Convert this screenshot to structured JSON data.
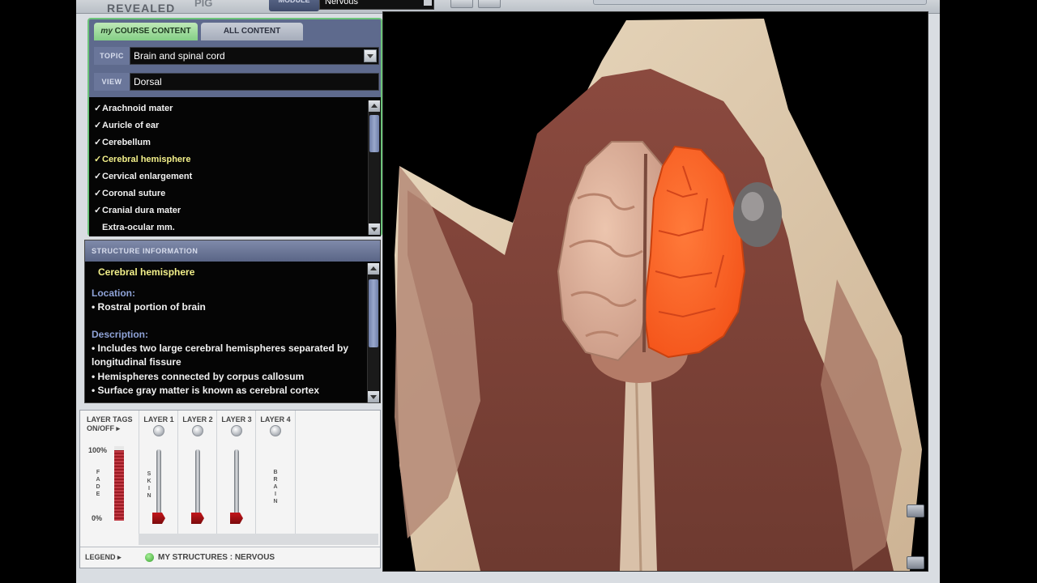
{
  "header": {
    "brand_line": "REVEALED",
    "brand_sub": "PIG",
    "module_label": "MODULE",
    "module_value": "Nervous"
  },
  "course_panel": {
    "tabs": [
      {
        "prefix": "my",
        "label": "COURSE CONTENT",
        "active": true
      },
      {
        "label": "ALL CONTENT",
        "active": false
      }
    ],
    "topic_label": "TOPIC",
    "topic_value": "Brain and spinal cord",
    "view_label": "VIEW",
    "view_value": "Dorsal"
  },
  "structures": [
    {
      "label": "Arachnoid mater",
      "checked": true
    },
    {
      "label": "Auricle of ear",
      "checked": true
    },
    {
      "label": "Cerebellum",
      "checked": true
    },
    {
      "label": "Cerebral hemisphere",
      "checked": true,
      "selected": true
    },
    {
      "label": "Cervical enlargement",
      "checked": true
    },
    {
      "label": "Coronal suture",
      "checked": true
    },
    {
      "label": "Cranial dura mater",
      "checked": true
    },
    {
      "label": "Extra-ocular mm.",
      "checked": false
    }
  ],
  "structure_info": {
    "header": "STRUCTURE INFORMATION",
    "title": "Cerebral hemisphere",
    "location_heading": "Location:",
    "location_items": [
      "• Rostral portion of brain"
    ],
    "description_heading": "Description:",
    "description_items": [
      "• Includes two large cerebral hemispheres separated by longitudinal fissure",
      "• Hemispheres connected by corpus callosum",
      "• Surface gray matter is known as cerebral cortex"
    ]
  },
  "layers_panel": {
    "tags_label": "LAYER TAGS",
    "onoff_label": "ON/OFF ▸",
    "fade_top": "100%",
    "fade_bottom": "0%",
    "fade_word": "FADE",
    "fade_level": 0.95,
    "layers": [
      {
        "name": "LAYER 1",
        "tag": "SKIN",
        "level": 0.0,
        "has_slider": true
      },
      {
        "name": "LAYER 2",
        "tag": "",
        "level": 0.0,
        "has_slider": true
      },
      {
        "name": "LAYER 3",
        "tag": "",
        "level": 0.0,
        "has_slider": true
      },
      {
        "name": "LAYER 4",
        "tag": "BRAIN",
        "level": 0.0,
        "has_slider": false
      }
    ],
    "legend_label": "LEGEND ▸",
    "legend_text": "MY STRUCTURES : NERVOUS"
  },
  "colors": {
    "selected_text": "#f3f08a",
    "highlight_structure": "#ff5a1f",
    "heading_blue": "#8fa3d8",
    "panel_green": "#6cc47a"
  }
}
